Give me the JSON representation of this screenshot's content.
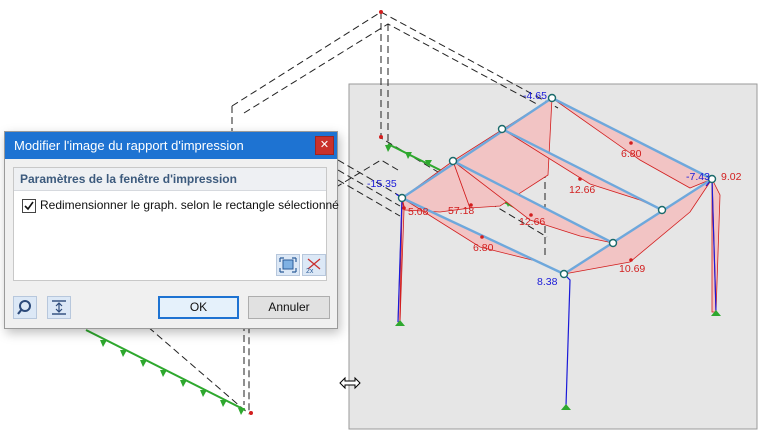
{
  "dialog": {
    "title": "Modifier l'image du rapport d'impression",
    "close_icon": "close-icon",
    "group_title": "Paramètres de la fenêtre d'impression",
    "resize_checkbox": {
      "label": "Redimensionner le graph. selon le rectangle sélectionné",
      "checked": true
    },
    "tool_icons": [
      "fit-to-rectangle-icon",
      "scale-2x-icon"
    ],
    "footer_icons": [
      "search-icon",
      "fit-vertical-icon"
    ],
    "ok_label": "OK",
    "cancel_label": "Annuler"
  },
  "model_view": {
    "labels": [
      {
        "id": "v1",
        "text": "-4.65",
        "color": "#1a1ad8"
      },
      {
        "id": "v2",
        "text": "6.80",
        "color": "#d21e1e"
      },
      {
        "id": "v3",
        "text": "12.66",
        "color": "#d21e1e"
      },
      {
        "id": "v4",
        "text": "-7.43",
        "color": "#1a1ad8"
      },
      {
        "id": "v5",
        "text": "9.02",
        "color": "#d21e1e"
      },
      {
        "id": "v6",
        "text": "-15.35",
        "color": "#1a1ad8"
      },
      {
        "id": "v7",
        "text": "5.08",
        "color": "#d21e1e"
      },
      {
        "id": "v8",
        "text": "57.18",
        "color": "#d21e1e"
      },
      {
        "id": "v9",
        "text": "12.66",
        "color": "#d21e1e"
      },
      {
        "id": "v10",
        "text": "6.80",
        "color": "#d21e1e"
      },
      {
        "id": "v11",
        "text": "10.69",
        "color": "#d21e1e"
      },
      {
        "id": "v12",
        "text": "8.38",
        "color": "#1a1ad8"
      }
    ],
    "colors": {
      "positive": "#d21e1e",
      "negative": "#1a1ad8",
      "fill": "#f2c4c4",
      "member": "#6ea8dc",
      "support": "#2e9e2e",
      "selection": "#e6e6e6"
    }
  },
  "cursor_icon": "resize-horizontal-cursor-icon"
}
